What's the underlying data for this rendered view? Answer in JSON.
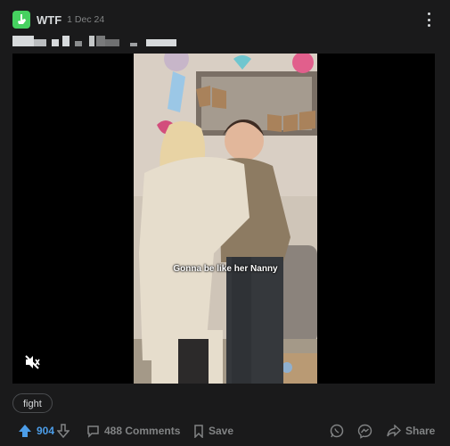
{
  "post": {
    "group_name": "WTF",
    "date": "1 Dec 24",
    "caption": "Gonna be like her Nanny",
    "banner_text": "BOY GIRL",
    "flair": "fight"
  },
  "actions": {
    "upvotes": "904",
    "comments": "488 Comments",
    "save": "Save",
    "share": "Share"
  },
  "colors": {
    "accent_vote": "#4c9de8",
    "group_icon": "#46d160",
    "background": "#1a1a1b"
  }
}
